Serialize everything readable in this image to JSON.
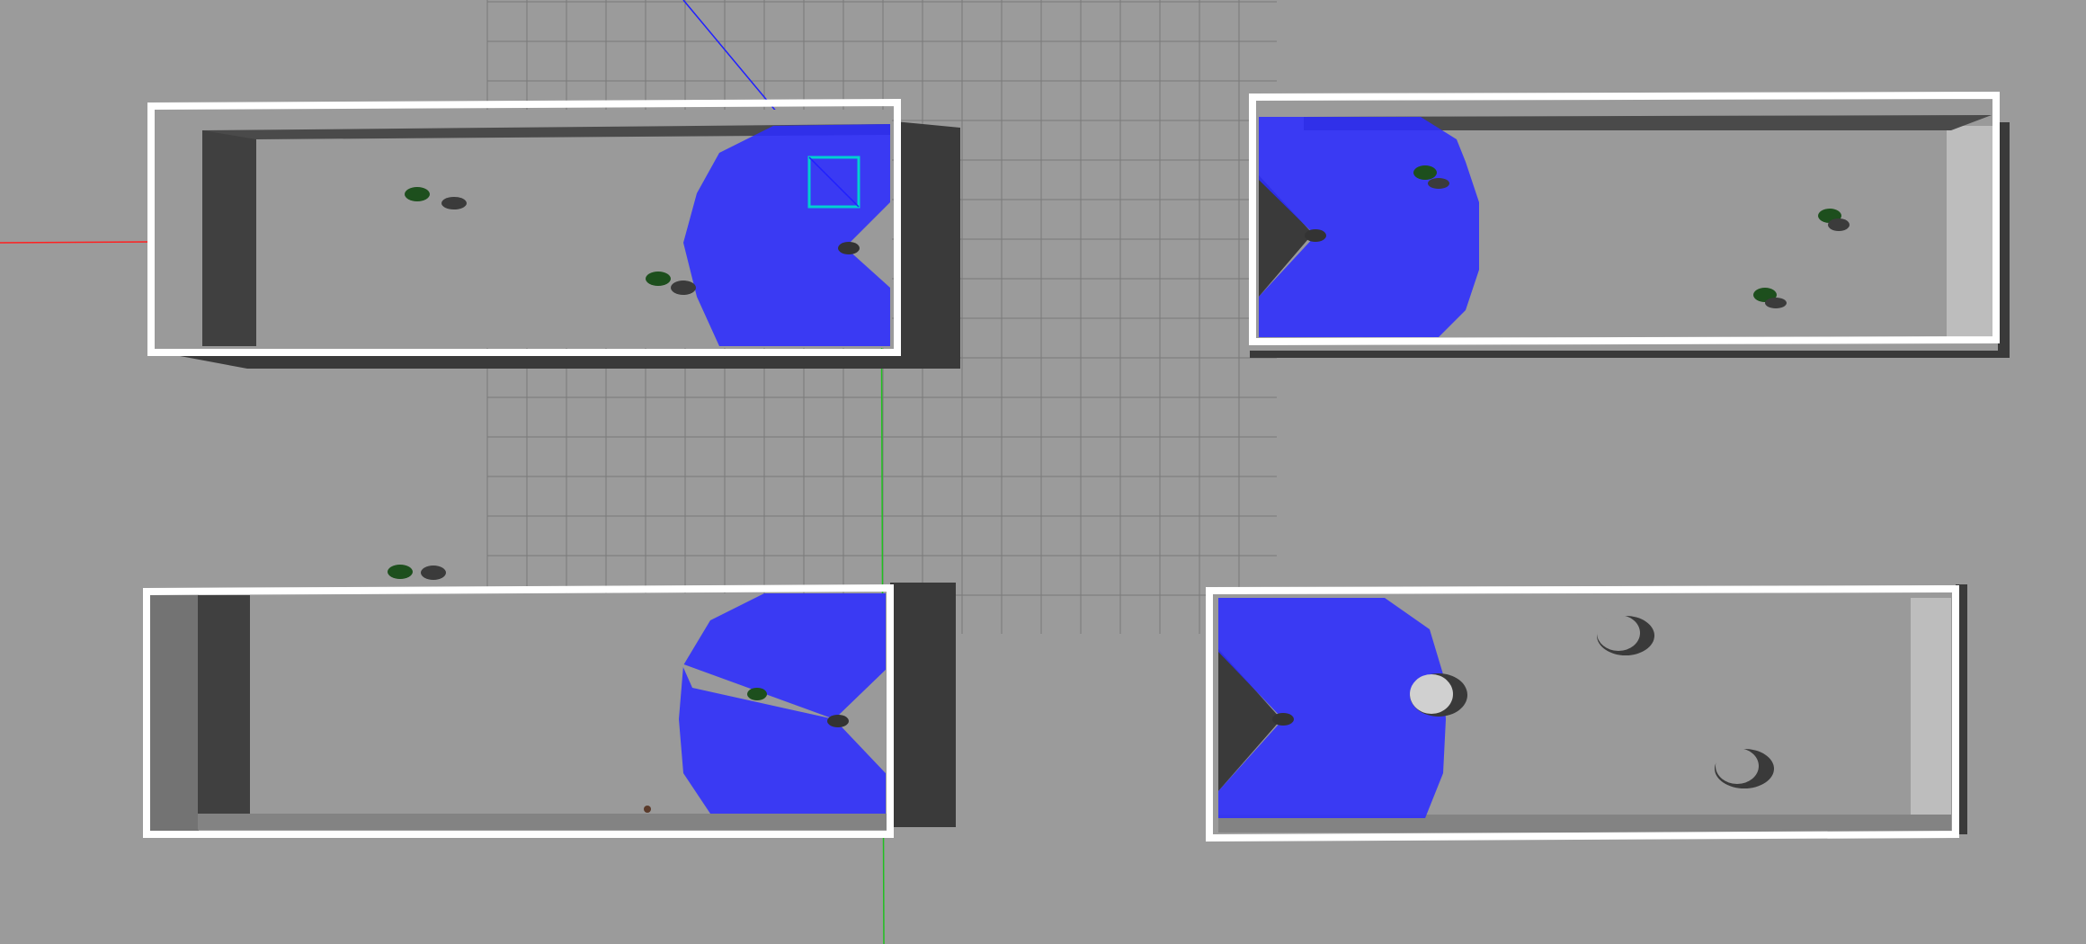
{
  "viewport": {
    "kind": "3d-simulation-top-view",
    "background_color": "#9b9b9b",
    "ground_grid": {
      "visible": true,
      "color": "#7a7a7a"
    },
    "axes": {
      "x_color": "#ff0000",
      "y_color": "#00c000",
      "z_color": "#0000ff"
    },
    "lidar_color": "#2020ff"
  },
  "scene": {
    "rooms": [
      {
        "id": "room-top-left",
        "wall_color": "#ffffff",
        "interior": "#999999",
        "lidar": true,
        "robot": "robot-top-left"
      },
      {
        "id": "room-top-right",
        "wall_color": "#ffffff",
        "interior": "#999999",
        "lidar": true,
        "robot": "robot-top-right"
      },
      {
        "id": "room-bottom-left",
        "wall_color": "#ffffff",
        "interior": "#999999",
        "lidar": true,
        "robot": "robot-bottom-left"
      },
      {
        "id": "room-bottom-right",
        "wall_color": "#ffffff",
        "interior": "#999999",
        "lidar": true,
        "robot": "robot-bottom-right"
      }
    ],
    "actors": {
      "people_count": 8,
      "cylinder_obstacles_count": 3
    },
    "selection": {
      "visible": true,
      "color": "#00d0d0",
      "target": "robot-top-left"
    }
  }
}
